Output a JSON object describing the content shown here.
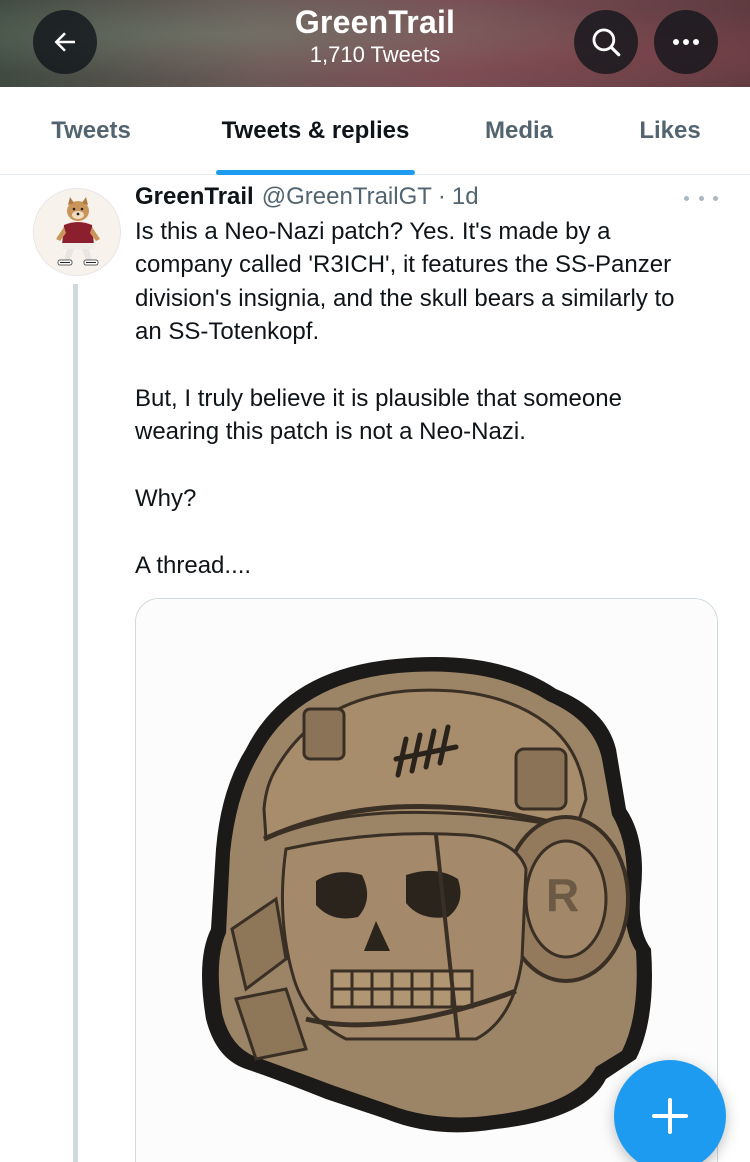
{
  "header": {
    "title": "GreenTrail",
    "subtitle": "1,710 Tweets",
    "back_icon": "arrow-left-icon",
    "search_icon": "search-icon",
    "more_icon": "more-horizontal-icon"
  },
  "tabs": [
    {
      "label": "Tweets",
      "active": false
    },
    {
      "label": "Tweets & replies",
      "active": true
    },
    {
      "label": "Media",
      "active": false
    },
    {
      "label": "Likes",
      "active": false
    }
  ],
  "tweet": {
    "name": "GreenTrail",
    "handle": "@GreenTrailGT",
    "separator": "·",
    "time": "1d",
    "paragraphs": [
      "Is this a Neo-Nazi patch? Yes. It's made by a company called 'R3ICH', it features the SS-Panzer division's insignia, and the skull bears a similarly to an SS-Totenkopf.",
      "But, I truly believe it is plausible that someone wearing this patch is not a Neo-Nazi.",
      "Why?",
      "A thread...."
    ],
    "media_icon_text": "R"
  },
  "fab": {
    "icon": "compose-plus-icon"
  },
  "colors": {
    "accent": "#1d9bf0",
    "text_primary": "#0f1419",
    "text_secondary": "#536471",
    "patch_tan": "#9c8466",
    "patch_border": "#1c1a18"
  }
}
